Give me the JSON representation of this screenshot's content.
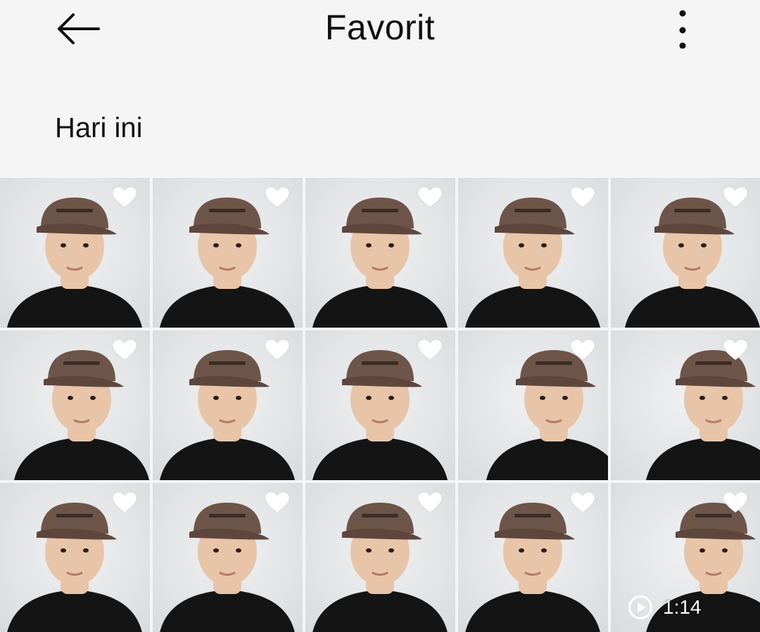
{
  "header": {
    "title": "Favorit",
    "back_icon": "arrow-left-icon",
    "more_icon": "more-vertical-icon"
  },
  "section": {
    "label": "Hari ini"
  },
  "colors": {
    "background": "#f5f5f5",
    "cap": "#6e5549",
    "shirt": "#141414",
    "skin": "#e8c4a8",
    "heart": "#ffffff"
  },
  "grid": {
    "items": [
      {
        "type": "photo",
        "favorite": true
      },
      {
        "type": "photo",
        "favorite": true
      },
      {
        "type": "photo",
        "favorite": true
      },
      {
        "type": "photo",
        "favorite": true
      },
      {
        "type": "photo",
        "favorite": true
      },
      {
        "type": "photo",
        "favorite": true
      },
      {
        "type": "photo",
        "favorite": true
      },
      {
        "type": "photo",
        "favorite": true
      },
      {
        "type": "photo",
        "favorite": true
      },
      {
        "type": "photo",
        "favorite": true
      },
      {
        "type": "photo",
        "favorite": true
      },
      {
        "type": "photo",
        "favorite": true
      },
      {
        "type": "photo",
        "favorite": true
      },
      {
        "type": "photo",
        "favorite": true
      },
      {
        "type": "video",
        "favorite": true,
        "duration": "1:14"
      }
    ]
  }
}
